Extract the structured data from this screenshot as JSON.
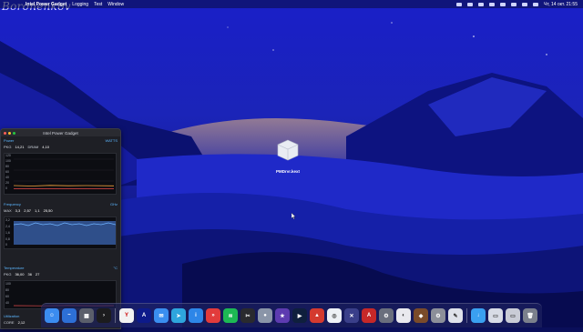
{
  "watermark": "Boronenkov",
  "menubar": {
    "app_name": "Intel Power Gadget",
    "menus": [
      "Logging",
      "Test",
      "Window"
    ],
    "clock": "Чт, 14 окт.  21:55"
  },
  "ipg_window": {
    "title": "Intel Power Gadget",
    "power": {
      "title": "Power",
      "unit": "WATTS",
      "pkg_label": "PKG",
      "pkg_value": "14,21",
      "dram_label": "DRAM",
      "dram_value": "4,10",
      "y_ticks": [
        "120",
        "100",
        "80",
        "60",
        "40",
        "20",
        "0"
      ]
    },
    "frequency": {
      "title": "Frequency",
      "unit": "GHz",
      "max_label": "MAX",
      "max_value": "3,3",
      "v1": "2,57",
      "v2": "1,1",
      "v3": "25,50",
      "y_ticks": [
        "3,2",
        "2,4",
        "1,6",
        "0,8",
        "0"
      ]
    },
    "temperature": {
      "title": "Temperature",
      "unit": "°C",
      "pkg_label": "PKG",
      "pkg_value": "36,00",
      "v1": "36",
      "v2": "27",
      "y_ticks": [
        "100",
        "80",
        "60",
        "40"
      ]
    },
    "utilization": {
      "title": "Utilization",
      "core_label": "CORE",
      "core_value": "2,12"
    }
  },
  "desktop_file": {
    "label": "PMDrvr.kext"
  }
}
